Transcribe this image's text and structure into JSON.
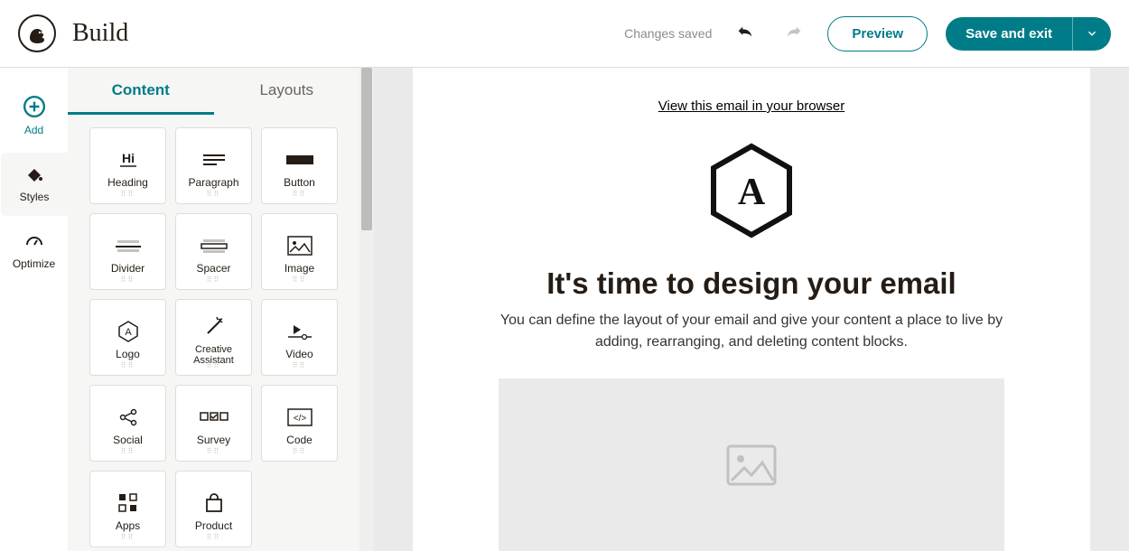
{
  "header": {
    "title": "Build",
    "status": "Changes saved",
    "preview_label": "Preview",
    "save_label": "Save and exit"
  },
  "rail": {
    "add": "Add",
    "styles": "Styles",
    "optimize": "Optimize"
  },
  "tabs": {
    "content": "Content",
    "layouts": "Layouts"
  },
  "blocks": [
    {
      "label": "Heading"
    },
    {
      "label": "Paragraph"
    },
    {
      "label": "Button"
    },
    {
      "label": "Divider"
    },
    {
      "label": "Spacer"
    },
    {
      "label": "Image"
    },
    {
      "label": "Logo"
    },
    {
      "label": "Creative Assistant"
    },
    {
      "label": "Video"
    },
    {
      "label": "Social"
    },
    {
      "label": "Survey"
    },
    {
      "label": "Code"
    },
    {
      "label": "Apps"
    },
    {
      "label": "Product"
    }
  ],
  "canvas": {
    "view_link": "View this email in your browser",
    "heading": "It's time to design your email",
    "body": "You can define the layout of your email and give your content a place to live by adding, rearranging, and deleting content blocks."
  }
}
